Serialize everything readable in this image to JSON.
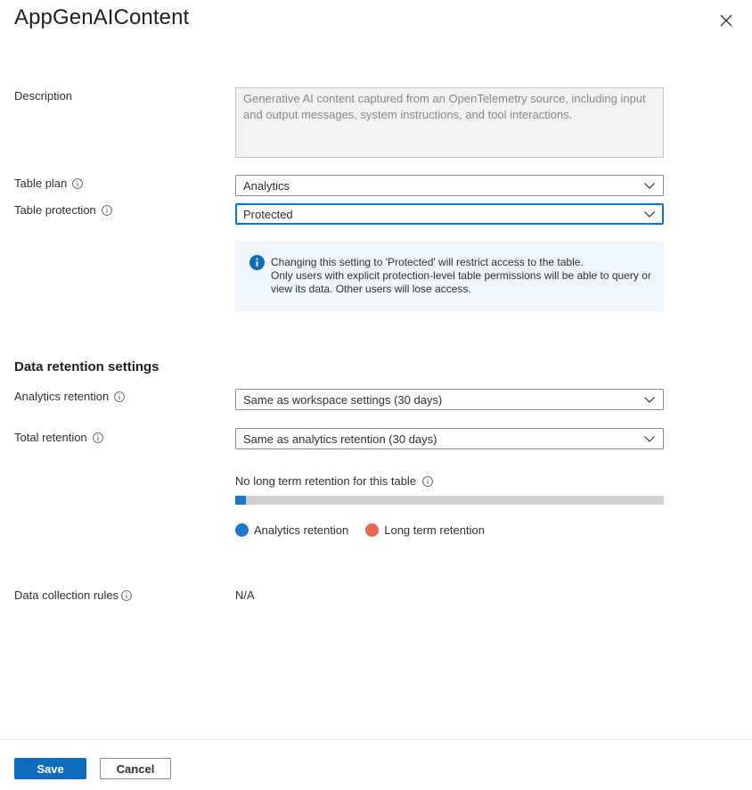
{
  "panel": {
    "title": "AppGenAIContent"
  },
  "fields": {
    "description_label": "Description",
    "description_value": "Generative AI content captured from an OpenTelemetry source, including input and output messages, system instructions, and tool interactions.",
    "table_plan_label": "Table plan",
    "table_plan_value": "Analytics",
    "table_protection_label": "Table protection",
    "table_protection_value": "Protected"
  },
  "infobar": {
    "line1": "Changing this setting to 'Protected' will restrict access to the table.",
    "line2": "Only users with explicit protection-level table permissions will be able to query or view its data. Other users will lose access."
  },
  "retention": {
    "heading": "Data retention settings",
    "analytics_label": "Analytics retention",
    "analytics_value": "Same as workspace settings (30 days)",
    "total_label": "Total retention",
    "total_value": "Same as analytics retention (30 days)",
    "note": "No long term retention for this table",
    "analytics_fraction": 0.025,
    "legend": [
      {
        "label": "Analytics retention",
        "color": "#1b77d0"
      },
      {
        "label": "Long term retention",
        "color": "#e8694d"
      }
    ]
  },
  "dcr": {
    "label": "Data collection rules",
    "value": "N/A"
  },
  "footer": {
    "save_label": "Save",
    "cancel_label": "Cancel"
  },
  "icons": {
    "close": "close-icon",
    "info": "info-icon",
    "chevron": "chevron-down-icon"
  }
}
